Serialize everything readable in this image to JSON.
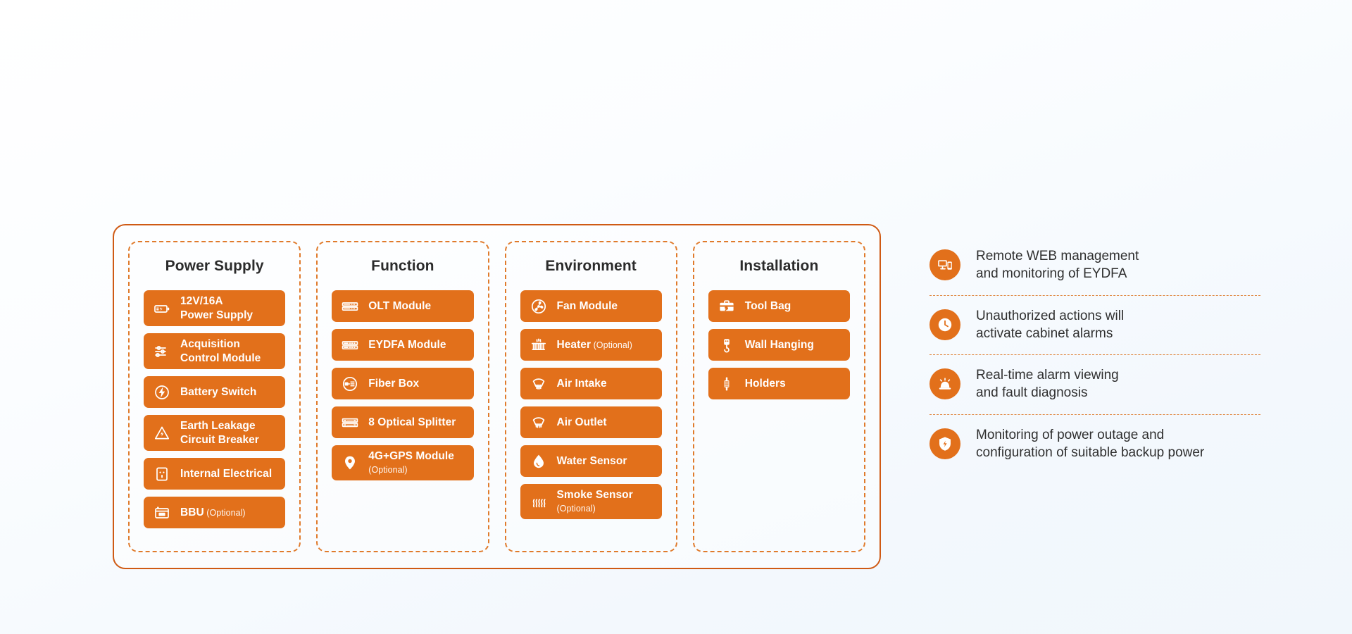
{
  "theme": {
    "accent": "#e2701b",
    "border_solid": "#cf5a14",
    "border_dashed": "#e07b2c",
    "text_dark": "#2b2b2b",
    "chip_text": "#ffffff",
    "separator": "#e08a45",
    "background": "#f3f8fd"
  },
  "spec_panel": {
    "columns": [
      {
        "title": "Power Supply",
        "items": [
          {
            "icon": "battery-bolt-icon",
            "line1": "12V/16A",
            "line2": "Power Supply",
            "optional": ""
          },
          {
            "icon": "sliders-icon",
            "line1": "Acquisition",
            "line2": "Control Module",
            "optional": ""
          },
          {
            "icon": "battery-switch-bolt-icon",
            "line1": "Battery Switch",
            "line2": "",
            "optional": ""
          },
          {
            "icon": "warning-bolt-triangle-icon",
            "line1": "Earth Leakage",
            "line2": "Circuit Breaker",
            "optional": ""
          },
          {
            "icon": "power-socket-icon",
            "line1": "Internal Electrical",
            "line2": "",
            "optional": ""
          },
          {
            "icon": "bbu-rack-icon",
            "line1": "BBU",
            "line2": "",
            "optional": "(Optional)"
          }
        ]
      },
      {
        "title": "Function",
        "items": [
          {
            "icon": "olt-rack-icon",
            "line1": "OLT Module",
            "line2": "",
            "optional": ""
          },
          {
            "icon": "eydfa-rack-icon",
            "line1": "EYDFA Module",
            "line2": "",
            "optional": ""
          },
          {
            "icon": "fiber-box-icon",
            "line1": "Fiber Box",
            "line2": "",
            "optional": ""
          },
          {
            "icon": "optical-splitter-icon",
            "line1": "8 Optical Splitter",
            "line2": "",
            "optional": ""
          },
          {
            "icon": "map-pin-icon",
            "line1": "4G+GPS Module",
            "line2": "",
            "optional": "(Optional)"
          }
        ]
      },
      {
        "title": "Environment",
        "items": [
          {
            "icon": "fan-icon",
            "line1": "Fan Module",
            "line2": "",
            "optional": ""
          },
          {
            "icon": "heater-radiator-icon",
            "line1": "Heater",
            "line2": "",
            "optional": "(Optional)"
          },
          {
            "icon": "air-intake-vent-icon",
            "line1": "Air Intake",
            "line2": "",
            "optional": ""
          },
          {
            "icon": "air-outlet-vent-icon",
            "line1": "Air Outlet",
            "line2": "",
            "optional": ""
          },
          {
            "icon": "water-droplet-icon",
            "line1": "Water Sensor",
            "line2": "",
            "optional": ""
          },
          {
            "icon": "smoke-waves-icon",
            "line1": "Smoke Sensor",
            "line2": "",
            "optional": "(Optional)"
          }
        ]
      },
      {
        "title": "Installation",
        "items": [
          {
            "icon": "toolbox-icon",
            "line1": "Tool Bag",
            "line2": "",
            "optional": ""
          },
          {
            "icon": "wall-hook-icon",
            "line1": "Wall Hanging",
            "line2": "",
            "optional": ""
          },
          {
            "icon": "holder-bracket-icon",
            "line1": "Holders",
            "line2": "",
            "optional": ""
          }
        ]
      }
    ]
  },
  "features": {
    "items": [
      {
        "icon": "monitor-phone-icon",
        "line1": "Remote WEB management",
        "line2": "and monitoring of EYDFA"
      },
      {
        "icon": "clock-icon",
        "line1": "Unauthorized actions will",
        "line2": "activate cabinet alarms"
      },
      {
        "icon": "alarm-bell-icon",
        "line1": "Real-time alarm viewing",
        "line2": "and fault diagnosis"
      },
      {
        "icon": "shield-bolt-icon",
        "line1": "Monitoring of power outage and",
        "line2": "configuration of suitable backup power"
      }
    ]
  }
}
